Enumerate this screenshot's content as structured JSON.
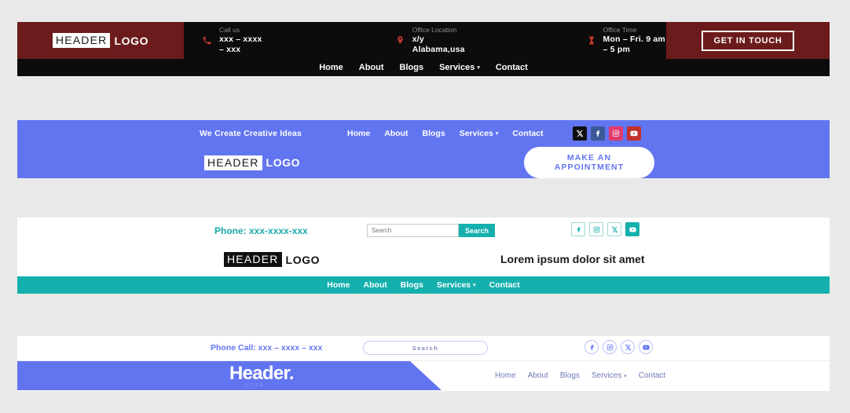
{
  "page": {
    "background": "#e9e9e9"
  },
  "header1": {
    "logo": {
      "chip": "HEADER",
      "word": "LOGO",
      "bg": "#6b1b1b"
    },
    "infos": [
      {
        "icon": "phone-icon",
        "label": "Call us",
        "value": "xxx – xxxx – xxx"
      },
      {
        "icon": "location-pin-icon",
        "label": "Office Location",
        "value": "x/y Alabama,usa"
      },
      {
        "icon": "hourglass-icon",
        "label": "Office Time",
        "value": "Mon – Fri. 9 am – 5 pm"
      }
    ],
    "cta": "GET IN TOUCH",
    "nav": [
      {
        "label": "Home",
        "caret": false
      },
      {
        "label": "About",
        "caret": false
      },
      {
        "label": "Blogs",
        "caret": false
      },
      {
        "label": "Services",
        "caret": true
      },
      {
        "label": "Contact",
        "caret": false
      }
    ],
    "colors": {
      "bar": "#0d0b0b",
      "accent": "#6b1b1b",
      "icon": "#c0392b"
    }
  },
  "header2": {
    "tagline": "We Create Creative Ideas",
    "nav": [
      {
        "label": "Home",
        "caret": false
      },
      {
        "label": "About",
        "caret": false
      },
      {
        "label": "Blogs",
        "caret": false
      },
      {
        "label": "Services",
        "caret": true
      },
      {
        "label": "Contact",
        "caret": false
      }
    ],
    "socials": [
      {
        "name": "x-twitter-icon",
        "color": "#0f0f0f"
      },
      {
        "name": "facebook-icon",
        "color": "#3b5998"
      },
      {
        "name": "instagram-icon",
        "color": "#e1396c"
      },
      {
        "name": "youtube-icon",
        "color": "#c4302b"
      }
    ],
    "logo": {
      "chip": "HEADER",
      "word": "LOGO"
    },
    "appointment_button": "MAKE AN APPOINTMENT",
    "colors": {
      "bar": "#6275f0",
      "button_text": "#6275f0"
    }
  },
  "header3": {
    "phone": "Phone: xxx-xxxx-xxx",
    "search": {
      "placeholder": "Search",
      "value": "",
      "button": "Search"
    },
    "socials": [
      {
        "name": "facebook-icon"
      },
      {
        "name": "instagram-icon"
      },
      {
        "name": "x-twitter-icon"
      },
      {
        "name": "youtube-icon"
      }
    ],
    "logo": {
      "chip": "HEADER",
      "word": "LOGO"
    },
    "tagline": "Lorem ipsum dolor sit amet",
    "nav": [
      {
        "label": "Home",
        "caret": false
      },
      {
        "label": "About",
        "caret": false
      },
      {
        "label": "Blogs",
        "caret": false
      },
      {
        "label": "Services",
        "caret": true
      },
      {
        "label": "Contact",
        "caret": false
      }
    ],
    "colors": {
      "accent": "#14b0ae",
      "phone": "#1aa9a9"
    }
  },
  "header4": {
    "phone": "Phone Call: xxx – xxxx – xxx",
    "search": {
      "placeholder": "Search",
      "value": ""
    },
    "socials": [
      {
        "name": "facebook-icon"
      },
      {
        "name": "instagram-icon"
      },
      {
        "name": "x-twitter-icon"
      },
      {
        "name": "youtube-icon"
      }
    ],
    "brand": "Header.",
    "brand_sub": "LOGO",
    "nav": [
      {
        "label": "Home",
        "caret": false
      },
      {
        "label": "About",
        "caret": false
      },
      {
        "label": "Blogs",
        "caret": false
      },
      {
        "label": "Services",
        "caret": true
      },
      {
        "label": "Contact",
        "caret": false
      }
    ],
    "colors": {
      "accent": "#6275f0",
      "nav_text": "#6f78b5"
    }
  }
}
